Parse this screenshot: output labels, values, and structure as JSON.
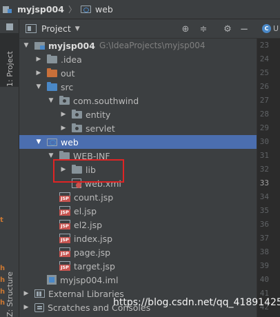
{
  "breadcrumb": {
    "project": "myjsp004",
    "folder": "web"
  },
  "tool_strip": {
    "project_tab": "1: Project",
    "structure_tab": "Z: Structure"
  },
  "panel": {
    "title": "Project"
  },
  "tree": [
    {
      "label": "myjsp004",
      "path": "G:\\IdeaProjects\\myjsp004"
    },
    {
      "label": ".idea"
    },
    {
      "label": "out"
    },
    {
      "label": "src"
    },
    {
      "label": "com.southwind"
    },
    {
      "label": "entity"
    },
    {
      "label": "servlet"
    },
    {
      "label": "web"
    },
    {
      "label": "WEB-INF"
    },
    {
      "label": "lib"
    },
    {
      "label": "web.xml"
    },
    {
      "label": "count.jsp"
    },
    {
      "label": "el.jsp"
    },
    {
      "label": "el2.jsp"
    },
    {
      "label": "index.jsp"
    },
    {
      "label": "page.jsp"
    },
    {
      "label": "target.jsp"
    },
    {
      "label": "myjsp004.iml"
    },
    {
      "label": "External Libraries"
    },
    {
      "label": "Scratches and Consoles"
    }
  ],
  "editor": {
    "tab_letter": "U",
    "line_numbers": [
      "23",
      "24",
      "25",
      "26",
      "27",
      "28",
      "29",
      "30",
      "31",
      "32",
      "33",
      "34",
      "35",
      "36",
      "37",
      "38",
      "39",
      "40",
      "41",
      "42"
    ],
    "current_line": "33"
  },
  "gutter_letters": [
    "t",
    "h",
    "h",
    "h",
    "h"
  ],
  "watermark": "https://blog.csdn.net/qq_41891425"
}
